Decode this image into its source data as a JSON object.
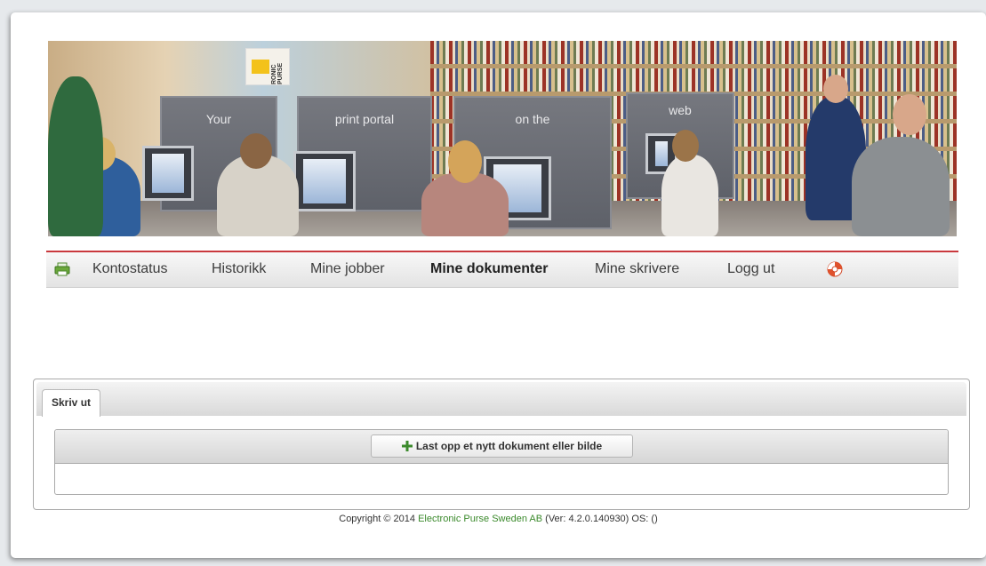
{
  "banner": {
    "panel_texts": [
      "Your",
      "print portal",
      "on the",
      "web"
    ],
    "logo_text": "RONIC PURSE"
  },
  "nav": {
    "items": [
      {
        "label": "Kontostatus"
      },
      {
        "label": "Historikk"
      },
      {
        "label": "Mine jobber"
      },
      {
        "label": "Mine dokumenter"
      },
      {
        "label": "Mine skrivere"
      },
      {
        "label": "Logg ut"
      }
    ],
    "active_index": 3,
    "accent_color": "#c9393d"
  },
  "tabs": [
    {
      "label": "Skriv ut"
    }
  ],
  "upload": {
    "button_label": "Last opp et nytt dokument eller bilde",
    "icon": "plus-icon",
    "icon_color": "#3b8a2c"
  },
  "footer": {
    "prefix": "Copyright © 2014 ",
    "company": "Electronic Purse Sweden AB",
    "suffix": " (Ver: 4.2.0.140930) OS: ()"
  }
}
